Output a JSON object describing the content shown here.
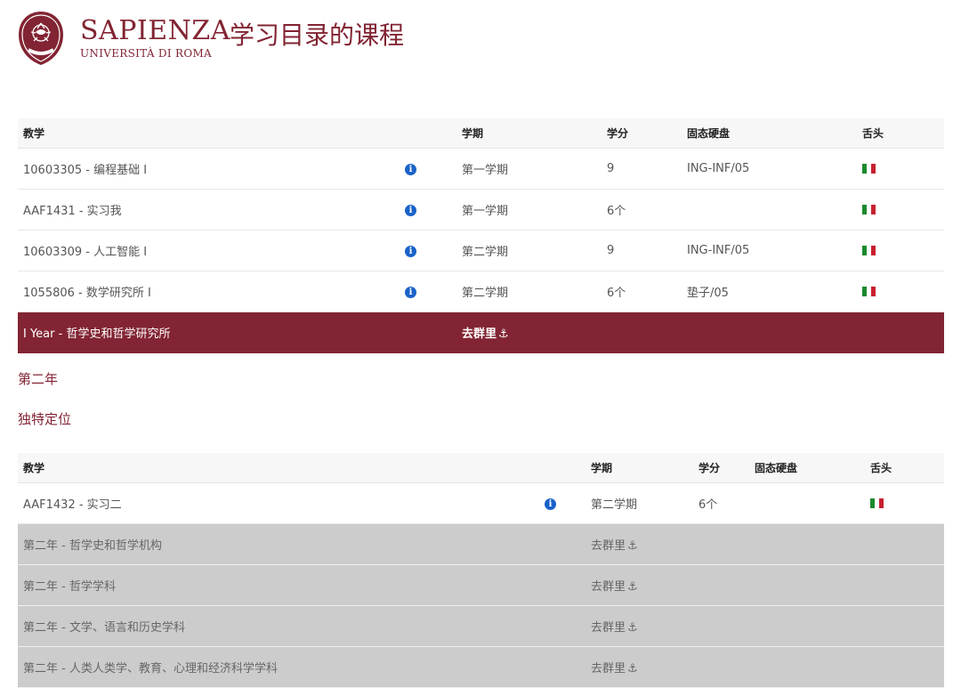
{
  "header": {
    "brand_name": "SAPIENZA",
    "brand_sub": "UNIVERSITÀ DI ROMA",
    "seal_text": "STVDIVM VRBIS",
    "title": "学习目录的课程"
  },
  "colors": {
    "accent": "#822433",
    "info": "#1a62c9",
    "grey_row": "#cccccc"
  },
  "table1": {
    "headers": [
      "教学",
      "学期",
      "学分",
      "固态硬盘",
      "舌头"
    ],
    "rows": [
      {
        "course": "10603305 - 编程基础 I",
        "semester": "第一学期",
        "credits": "9",
        "ssd": "ING-INF/05",
        "lang": "it-flag"
      },
      {
        "course": "AAF1431 - 实习我",
        "semester": "第一学期",
        "credits": "6个",
        "ssd": "",
        "lang": "it-flag"
      },
      {
        "course": "10603309 - 人工智能 I",
        "semester": "第二学期",
        "credits": "9",
        "ssd": "ING-INF/05",
        "lang": "it-flag"
      },
      {
        "course": "1055806 - 数学研究所 I",
        "semester": "第二学期",
        "credits": "6个",
        "ssd": "垫子/05",
        "lang": "it-flag"
      }
    ],
    "group_row": {
      "label": "I Year - 哲学史和哲学研究所",
      "link": "去群里"
    }
  },
  "year2": {
    "heading": "第二年",
    "subheading": "独特定位"
  },
  "table2": {
    "headers": [
      "教学",
      "学期",
      "学分",
      "固态硬盘",
      "舌头"
    ],
    "rows": [
      {
        "course": "AAF1432 - 实习二",
        "semester": "第二学期",
        "credits": "6个",
        "ssd": "",
        "lang": "it-flag"
      }
    ],
    "group_rows": [
      {
        "label": "第二年 - 哲学史和哲学机构",
        "link": "去群里"
      },
      {
        "label": "第二年 - 哲学学科",
        "link": "去群里"
      },
      {
        "label": "第二年 - 文学、语言和历史学科",
        "link": "去群里"
      },
      {
        "label": "第二年 - 人类人类学、教育、心理和经济科学学科",
        "link": "去群里"
      }
    ]
  }
}
